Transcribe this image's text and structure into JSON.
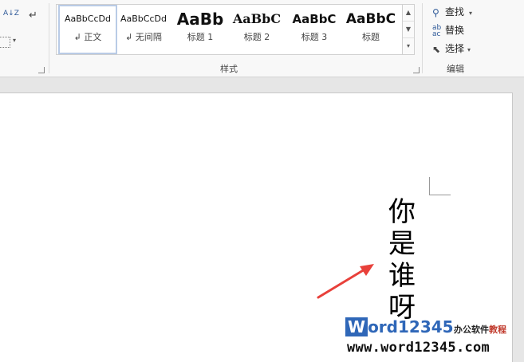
{
  "ribbon": {
    "paragraph_group": {
      "sort_label": "A↓Z",
      "show_marks_label": "↵"
    },
    "styles": {
      "group_label": "样式",
      "items": [
        {
          "preview": "AaBbCcDd",
          "name": "↲ 正文"
        },
        {
          "preview": "AaBbCcDd",
          "name": "↲ 无间隔"
        },
        {
          "preview": "AaBb",
          "name": "标题 1"
        },
        {
          "preview": "AaBbC",
          "name": "标题 2"
        },
        {
          "preview": "AaBbC",
          "name": "标题 3"
        },
        {
          "preview": "AaBbC",
          "name": "标题"
        }
      ]
    },
    "editing": {
      "group_label": "编辑",
      "find_label": "查找",
      "replace_label": "替换",
      "select_label": "选择"
    }
  },
  "document": {
    "vertical_text": [
      "你",
      "是",
      "谁",
      "呀"
    ]
  },
  "watermark": {
    "logo_word": "W",
    "logo_rest": "ord12345",
    "subtitle": "办公软件",
    "subtitle_emphasis": "教程",
    "url": "www.word12345.com"
  },
  "colors": {
    "arrow": "#e8403a",
    "logo_blue": "#2f67b8"
  }
}
